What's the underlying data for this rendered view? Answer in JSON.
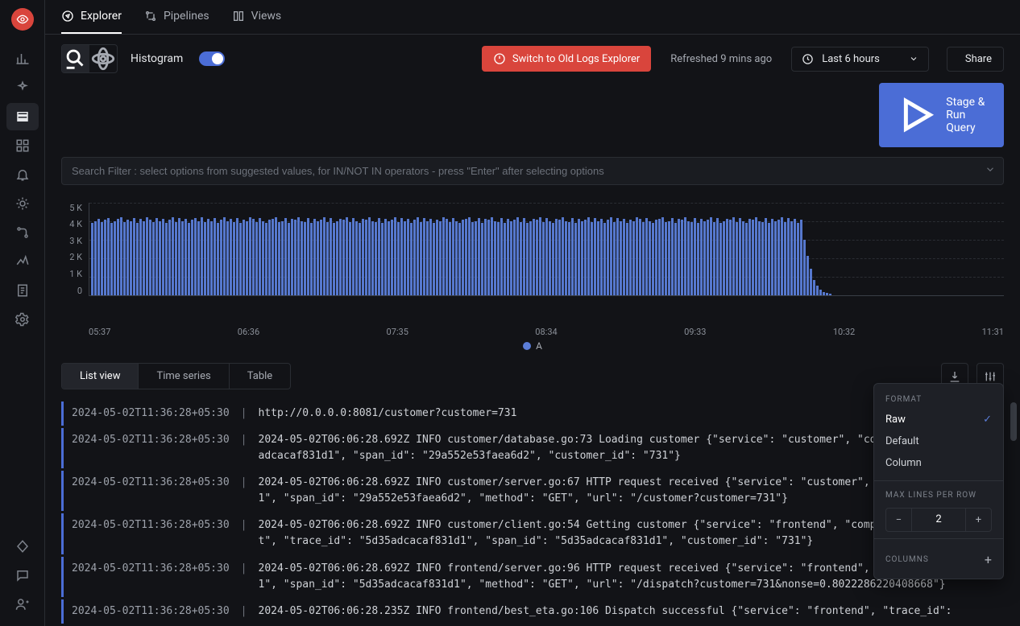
{
  "sidebar": {
    "top_icons": [
      "bar-chart",
      "sparkle",
      "layers",
      "grid",
      "bell",
      "bug",
      "route",
      "rising-chart",
      "doc",
      "gear"
    ],
    "bottom_icons": [
      "diamond",
      "message",
      "user"
    ]
  },
  "tabs": [
    {
      "label": "Explorer",
      "icon": "compass",
      "active": true
    },
    {
      "label": "Pipelines",
      "icon": "pipeline",
      "active": false
    },
    {
      "label": "Views",
      "icon": "grid-view",
      "active": false
    }
  ],
  "histogram_label": "Histogram",
  "switch_button": "Switch to Old Logs Explorer",
  "refreshed_text": "Refreshed 9 mins ago",
  "time_range": "Last 6 hours",
  "share_label": "Share",
  "run_button": "Stage & Run Query",
  "search_placeholder": "Search Filter : select options from suggested values, for IN/NOT IN operators - press \"Enter\" after selecting options",
  "chart_data": {
    "type": "bar",
    "ylabels": [
      "5 K",
      "4 K",
      "3 K",
      "2 K",
      "1 K",
      "0"
    ],
    "xlabels": [
      "05:37",
      "06:36",
      "07:35",
      "08:34",
      "09:33",
      "10:32",
      "11:31"
    ],
    "ylim": [
      0,
      5000
    ],
    "series": [
      {
        "name": "A"
      }
    ],
    "bar_heights_pct": [
      78,
      80,
      82,
      79,
      81,
      83,
      78,
      80,
      82,
      84,
      79,
      81,
      80,
      83,
      78,
      82,
      80,
      84,
      81,
      79,
      83,
      80,
      82,
      78,
      81,
      84,
      79,
      83,
      80,
      82,
      78,
      81,
      83,
      80,
      84,
      79,
      82,
      80,
      83,
      78,
      81,
      84,
      80,
      82,
      79,
      83,
      78,
      81,
      80,
      84,
      82,
      79,
      83,
      80,
      78,
      81,
      82,
      84,
      79,
      80,
      83,
      78,
      82,
      81,
      84,
      80,
      79,
      83,
      78,
      82,
      80,
      81,
      84,
      79,
      83,
      78,
      80,
      82,
      81,
      84,
      79,
      83,
      80,
      78,
      82,
      81,
      84,
      80,
      79,
      83,
      78,
      82,
      80,
      81,
      84,
      79,
      83,
      80,
      82,
      78,
      81,
      84,
      79,
      83,
      80,
      82,
      78,
      81,
      80,
      84,
      82,
      79,
      83,
      80,
      78,
      81,
      82,
      84,
      79,
      80,
      83,
      78,
      82,
      81,
      84,
      80,
      79,
      83,
      78,
      82,
      80,
      81,
      84,
      79,
      83,
      78,
      80,
      82,
      81,
      84,
      79,
      83,
      80,
      78,
      82,
      81,
      84,
      80,
      79,
      83,
      78,
      82,
      80,
      81,
      84,
      79,
      83,
      80,
      82,
      78,
      81,
      84,
      79,
      83,
      80,
      82,
      78,
      81,
      80,
      84,
      82,
      79,
      83,
      80,
      78,
      81,
      82,
      84,
      79,
      80,
      83,
      78,
      82,
      81,
      84,
      80,
      79,
      83,
      78,
      82,
      80,
      81,
      84,
      79,
      83,
      78,
      80,
      82,
      81,
      84,
      79,
      83,
      80,
      78,
      82,
      81,
      84,
      80,
      79,
      83,
      78,
      82,
      80,
      81,
      84,
      79,
      83,
      80,
      82,
      78,
      81,
      60,
      42,
      28,
      16,
      10,
      6,
      3,
      2,
      1
    ]
  },
  "view_tabs": [
    "List view",
    "Time series",
    "Table"
  ],
  "view_tab_active": 0,
  "logs": [
    {
      "ts": "2024-05-02T11:36:28+05:30",
      "msg": "http://0.0.0.0:8081/customer?customer=731"
    },
    {
      "ts": "2024-05-02T11:36:28+05:30",
      "msg": "2024-05-02T06:06:28.692Z INFO customer/database.go:73 Loading customer {\"service\": \"customer\", \"com… \"trace_id\": \"5d35adcacaf831d1\", \"span_id\": \"29a552e53faea6d2\", \"customer_id\": \"731\"}"
    },
    {
      "ts": "2024-05-02T11:36:28+05:30",
      "msg": "2024-05-02T06:06:28.692Z INFO customer/server.go:67 HTTP request received {\"service\": \"customer\", \"… \"5d35adcacaf831d1\", \"span_id\": \"29a552e53faea6d2\", \"method\": \"GET\", \"url\": \"/customer?customer=731\"}"
    },
    {
      "ts": "2024-05-02T11:36:28+05:30",
      "msg": "2024-05-02T06:06:28.692Z INFO customer/client.go:54 Getting customer {\"service\": \"frontend\", \"compo… \"customer_client\", \"trace_id\": \"5d35adcacaf831d1\", \"span_id\": \"5d35adcacaf831d1\", \"customer_id\": \"731\"}"
    },
    {
      "ts": "2024-05-02T11:36:28+05:30",
      "msg": "2024-05-02T06:06:28.692Z INFO frontend/server.go:96 HTTP request received {\"service\": \"frontend\", \"… \"5d35adcacaf831d1\", \"span_id\": \"5d35adcacaf831d1\", \"method\": \"GET\", \"url\": \"/dispatch?customer=731&nonse=0.8022286220408668\"}"
    },
    {
      "ts": "2024-05-02T11:36:28+05:30",
      "msg": "2024-05-02T06:06:28.235Z INFO frontend/best_eta.go:106 Dispatch successful {\"service\": \"frontend\", \"trace_id\":"
    }
  ],
  "popover": {
    "format_title": "FORMAT",
    "items": [
      "Raw",
      "Default",
      "Column"
    ],
    "selected": "Raw",
    "maxlines_title": "MAX LINES PER ROW",
    "maxlines_value": "2",
    "columns_title": "COLUMNS"
  }
}
